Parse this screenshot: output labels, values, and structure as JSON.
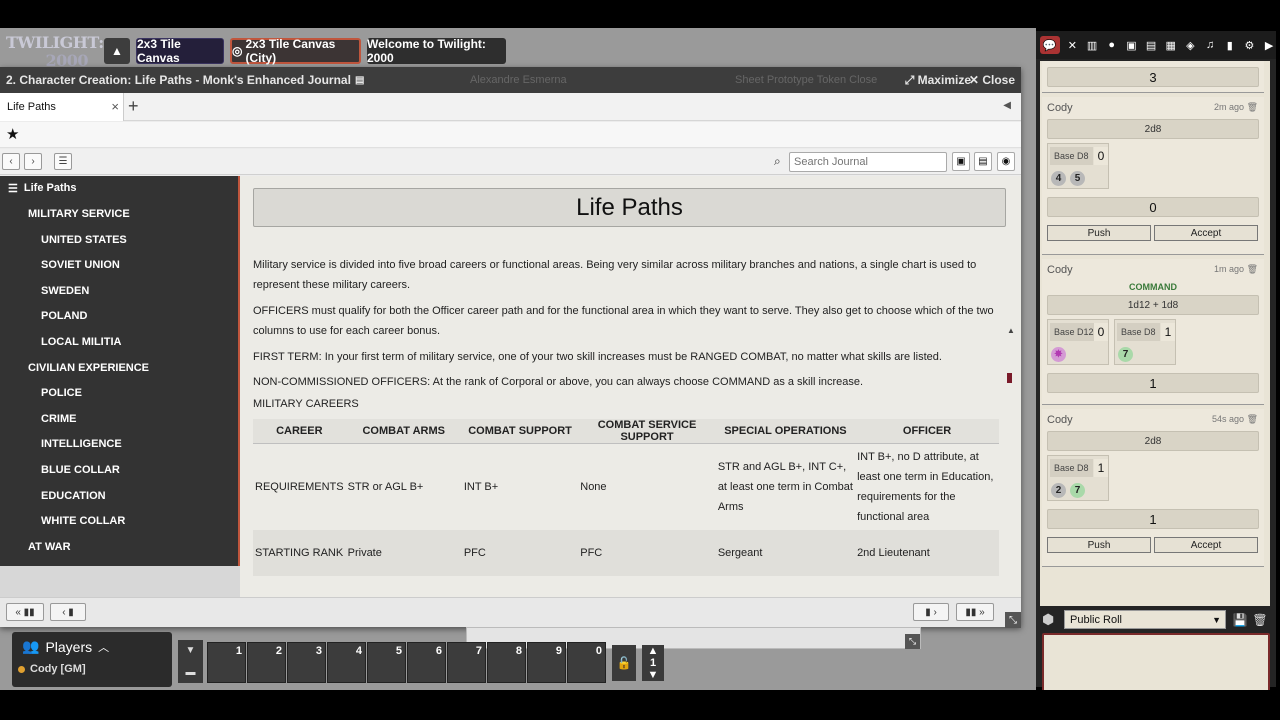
{
  "canvas": {
    "logo_line1": "TWILIGHT:",
    "logo_line2": "2000",
    "up_icon": "caret-up-icon",
    "pages": [
      "2x3 Tile Canvas",
      "2x3 Tile Canvas (City)",
      "Welcome to Twilight: 2000"
    ]
  },
  "journal": {
    "window_title": "2. Character Creation: Life Paths - Monk's Enhanced Journal",
    "ghost_name": "Alexandre Esmerna",
    "ghost_sheet": "Sheet",
    "ghost_token": "Prototype Token",
    "ghost_close": "Close",
    "maximize_label": "Maximize",
    "close_label": "Close",
    "tab_label": "Life Paths",
    "tab_close": "×",
    "tab_add": "+",
    "search_placeholder": "Search Journal",
    "accent_color": "#c0563d"
  },
  "sidebar": {
    "root": "Life Paths",
    "items": [
      {
        "label": "MILITARY SERVICE",
        "level": 1
      },
      {
        "label": "UNITED STATES",
        "level": 2
      },
      {
        "label": "SOVIET UNION",
        "level": 2
      },
      {
        "label": "SWEDEN",
        "level": 2
      },
      {
        "label": "POLAND",
        "level": 2
      },
      {
        "label": "LOCAL MILITIA",
        "level": 2
      },
      {
        "label": "CIVILIAN EXPERIENCE",
        "level": 1
      },
      {
        "label": "POLICE",
        "level": 2
      },
      {
        "label": "CRIME",
        "level": 2
      },
      {
        "label": "INTELLIGENCE",
        "level": 2
      },
      {
        "label": "BLUE COLLAR",
        "level": 2
      },
      {
        "label": "EDUCATION",
        "level": 2
      },
      {
        "label": "WHITE COLLAR",
        "level": 2
      },
      {
        "label": "AT WAR",
        "level": 1
      }
    ]
  },
  "page": {
    "title": "Life Paths",
    "paragraphs": [
      "Military service is divided into five broad careers or functional areas. Being very similar across military branches and nations, a single chart is used to represent these military careers.",
      "OFFICERS must qualify for both the Officer career path and for the functional area in which they want to serve. They also get to choose which of the two columns to use for each career bonus.",
      "FIRST TERM: In your first term of military service, one of your two skill increases must be RANGED COMBAT, no matter what skills are listed.",
      "NON-COMMISSIONED OFFICERS: At the rank of Corporal or above, you can always choose COMMAND as a skill increase."
    ],
    "careers_label": "MILITARY CAREERS",
    "table": {
      "headers": [
        "CAREER",
        "COMBAT ARMS",
        "COMBAT SUPPORT",
        "COMBAT SERVICE SUPPORT",
        "SPECIAL OPERATIONS",
        "OFFICER"
      ],
      "rows": [
        [
          "REQUIREMENTS",
          "STR or AGL B+",
          "INT B+",
          "None",
          "STR and AGL B+, INT C+, at least one term in Combat Arms",
          "INT B+, no D attribute, at least one term in Education, requirements for the functional area"
        ],
        [
          "STARTING RANK",
          "Private",
          "PFC",
          "PFC",
          "Sergeant",
          "2nd Lieutenant"
        ]
      ]
    }
  },
  "players": {
    "title": "Players",
    "list": [
      {
        "name": "Cody [GM]",
        "color": "#e0a030"
      }
    ]
  },
  "macro_bar": {
    "slots": [
      "1",
      "2",
      "3",
      "4",
      "5",
      "6",
      "7",
      "8",
      "9",
      "0"
    ],
    "page": "1"
  },
  "chat": {
    "top_total": "3",
    "messages": [
      {
        "who": "Cody",
        "when": "2m ago",
        "formula": "2d8",
        "pools": [
          {
            "label": "Base D8",
            "count": "0",
            "dice": [
              "4",
              "5"
            ]
          }
        ],
        "total": "0",
        "buttons": [
          "Push",
          "Accept"
        ]
      },
      {
        "who": "Cody",
        "when": "1m ago",
        "skill": "COMMAND",
        "formula": "1d12 + 1d8",
        "pools": [
          {
            "label": "Base D12",
            "count": "0",
            "dice": [
              "✸"
            ]
          },
          {
            "label": "Base D8",
            "count": "1",
            "dice": [
              "7"
            ]
          }
        ],
        "total": "1"
      },
      {
        "who": "Cody",
        "when": "54s ago",
        "formula": "2d8",
        "pools": [
          {
            "label": "Base D8",
            "count": "1",
            "dice": [
              "2",
              "7"
            ]
          }
        ],
        "total": "1",
        "buttons": [
          "Push",
          "Accept"
        ]
      }
    ],
    "roll_mode": "Public Roll"
  }
}
